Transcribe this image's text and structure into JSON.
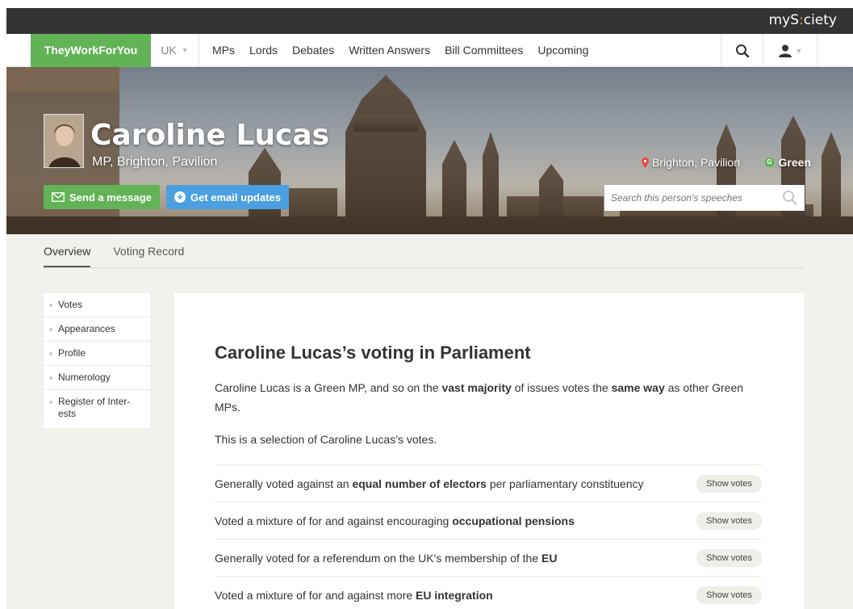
{
  "brand": {
    "mysociety": "myS",
    "mysociety_c": ":",
    "mysociety_tail": "ciety"
  },
  "nav": {
    "site": "TheyWorkForYou",
    "region": "UK",
    "links": [
      "MPs",
      "Lords",
      "Debates",
      "Written Answers",
      "Bill Committees",
      "Upcoming"
    ],
    "search_icon": "search-icon",
    "user_icon": "user-icon"
  },
  "person": {
    "name": "Caroline Lucas",
    "subtitle": "MP, Brighton, Pavilion",
    "constituency": "Brighton, Pavilion",
    "party_letter": "G",
    "party": "Green",
    "party_color": "#62b356"
  },
  "actions": {
    "send_message": "Send a message",
    "email_updates": "Get email updates",
    "search_placeholder": "Search this person's speeches"
  },
  "tabs": [
    "Overview",
    "Voting Record"
  ],
  "sidenav": [
    "Votes",
    "Appearances",
    "Profile",
    "Numerology",
    "Register of Inter-ests"
  ],
  "content": {
    "heading": "Caroline Lucas’s voting in Parliament",
    "intro_1": "Caroline Lucas is a Green MP, and so on the ",
    "intro_b1": "vast majority",
    "intro_2": " of issues votes the ",
    "intro_b2": "same way",
    "intro_3": " as other Green MPs.",
    "selection": "This is a selection of Caroline Lucas’s votes.",
    "show_votes": "Show votes",
    "votes": [
      {
        "pre": "Generally voted against an ",
        "bold": "equal number of electors",
        "post": " per parliamentary constituency"
      },
      {
        "pre": "Voted a mixture of for and against encouraging ",
        "bold": "occupational pensions",
        "post": ""
      },
      {
        "pre": "Generally voted for a referendum on the UK's membership of the ",
        "bold": "EU",
        "post": ""
      },
      {
        "pre": "Voted a mixture of for and against more ",
        "bold": "EU integration",
        "post": ""
      }
    ]
  },
  "colors": {
    "accent_green": "#62b356",
    "accent_blue": "#4a9fe0",
    "topbar": "#333333",
    "page_bg": "#f3f1eb"
  }
}
